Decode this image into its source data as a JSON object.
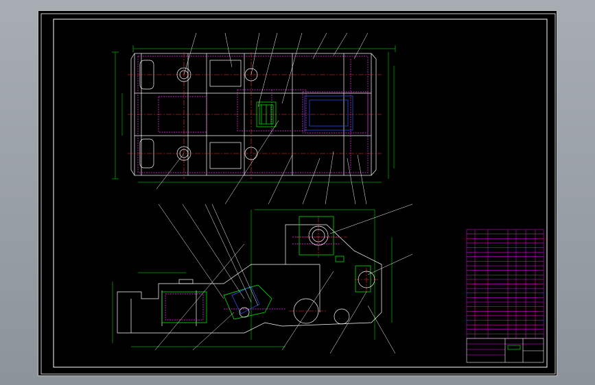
{
  "window": {
    "background": "#000000",
    "frame_color": "#ffffff"
  },
  "colors": {
    "outline": "#00ff00",
    "center_line": "#ff3030",
    "hidden_line": "#ff33ff",
    "dimension": "#00ff00",
    "part_blue": "#3355ff",
    "table_grid": "#ff00ff",
    "frame": "#ffffff"
  },
  "drawing": {
    "plan_view": {
      "label": "plan-view"
    },
    "elevation_view": {
      "label": "elevation-view"
    },
    "notes": {
      "title": "",
      "lines": [
        "",
        "",
        "",
        "",
        "",
        "",
        "",
        ""
      ]
    },
    "title_block": {
      "cells": []
    }
  }
}
